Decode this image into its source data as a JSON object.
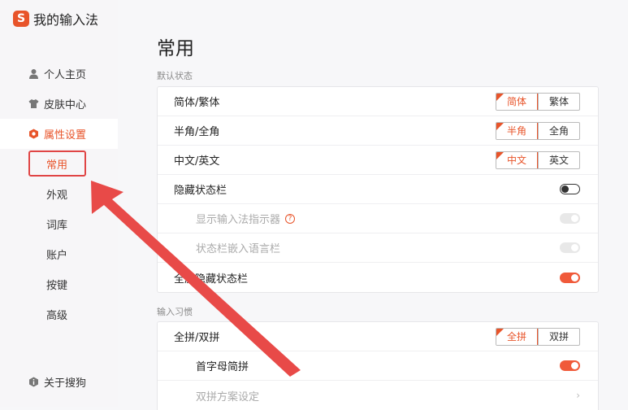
{
  "app": {
    "title": "我的输入法",
    "logo_letter": "S"
  },
  "window": {
    "feedback_icon": "feedback-icon",
    "minimize": "—",
    "close": "✕"
  },
  "sidebar": {
    "items": [
      {
        "label": "个人主页",
        "icon": "user-icon"
      },
      {
        "label": "皮肤中心",
        "icon": "shirt-icon"
      },
      {
        "label": "属性设置",
        "icon": "hexagon-gear-icon"
      }
    ],
    "sub_items": [
      {
        "label": "常用"
      },
      {
        "label": "外观"
      },
      {
        "label": "词库"
      },
      {
        "label": "账户"
      },
      {
        "label": "按键"
      },
      {
        "label": "高级"
      }
    ],
    "about": "关于搜狗"
  },
  "main": {
    "title": "常用",
    "sections": [
      {
        "label": "默认状态",
        "rows": [
          {
            "label": "简体/繁体",
            "options": [
              "简体",
              "繁体"
            ]
          },
          {
            "label": "半角/全角",
            "options": [
              "半角",
              "全角"
            ]
          },
          {
            "label": "中文/英文",
            "options": [
              "中文",
              "英文"
            ]
          },
          {
            "label": "隐藏状态栏"
          },
          {
            "label": "显示输入法指示器"
          },
          {
            "label": "状态栏嵌入语言栏"
          },
          {
            "label": "全屏隐藏状态栏"
          }
        ]
      },
      {
        "label": "输入习惯",
        "rows": [
          {
            "label": "全拼/双拼",
            "options": [
              "全拼",
              "双拼"
            ]
          },
          {
            "label": "首字母简拼"
          },
          {
            "label": "双拼方案设定"
          }
        ]
      }
    ]
  },
  "colors": {
    "accent": "#e8542a",
    "annotation": "#e04545"
  }
}
